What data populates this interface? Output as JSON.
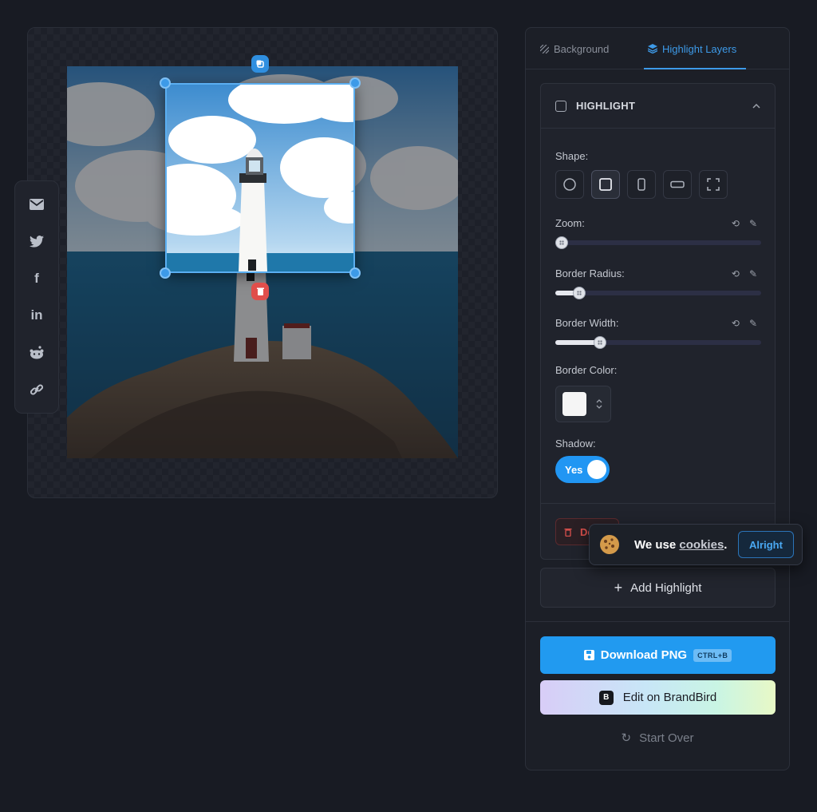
{
  "tabs": [
    {
      "label": "Background",
      "icon": "pattern-icon",
      "active": false
    },
    {
      "label": "Highlight Layers",
      "icon": "layers-icon",
      "active": true
    }
  ],
  "highlight_card": {
    "title": "HIGHLIGHT",
    "shape_label": "Shape:",
    "shapes": [
      "circle",
      "square",
      "portrait",
      "landscape",
      "fullscreen"
    ],
    "selected_shape": "square",
    "zoom_label": "Zoom:",
    "zoom_value": 0.0,
    "border_radius_label": "Border Radius:",
    "border_radius_value": 0.09,
    "border_width_label": "Border Width:",
    "border_width_value": 0.2,
    "border_color_label": "Border Color:",
    "border_color": "#f5f5f5",
    "shadow_label": "Shadow:",
    "shadow_toggle": "Yes",
    "delete_label": "De"
  },
  "add_highlight_label": "Add Highlight",
  "download": {
    "label": "Download PNG",
    "shortcut": "CTRL+B"
  },
  "brandbird": {
    "label": "Edit on BrandBird",
    "logo": "B"
  },
  "start_over_label": "Start Over",
  "cookie": {
    "text_before": "We use ",
    "link": "cookies",
    "text_after": ".",
    "button": "Alright"
  },
  "share": [
    "email",
    "twitter",
    "facebook",
    "linkedin",
    "reddit",
    "link"
  ],
  "colors": {
    "accent": "#219af0",
    "danger": "#d9504c",
    "bg": "#181b23"
  }
}
